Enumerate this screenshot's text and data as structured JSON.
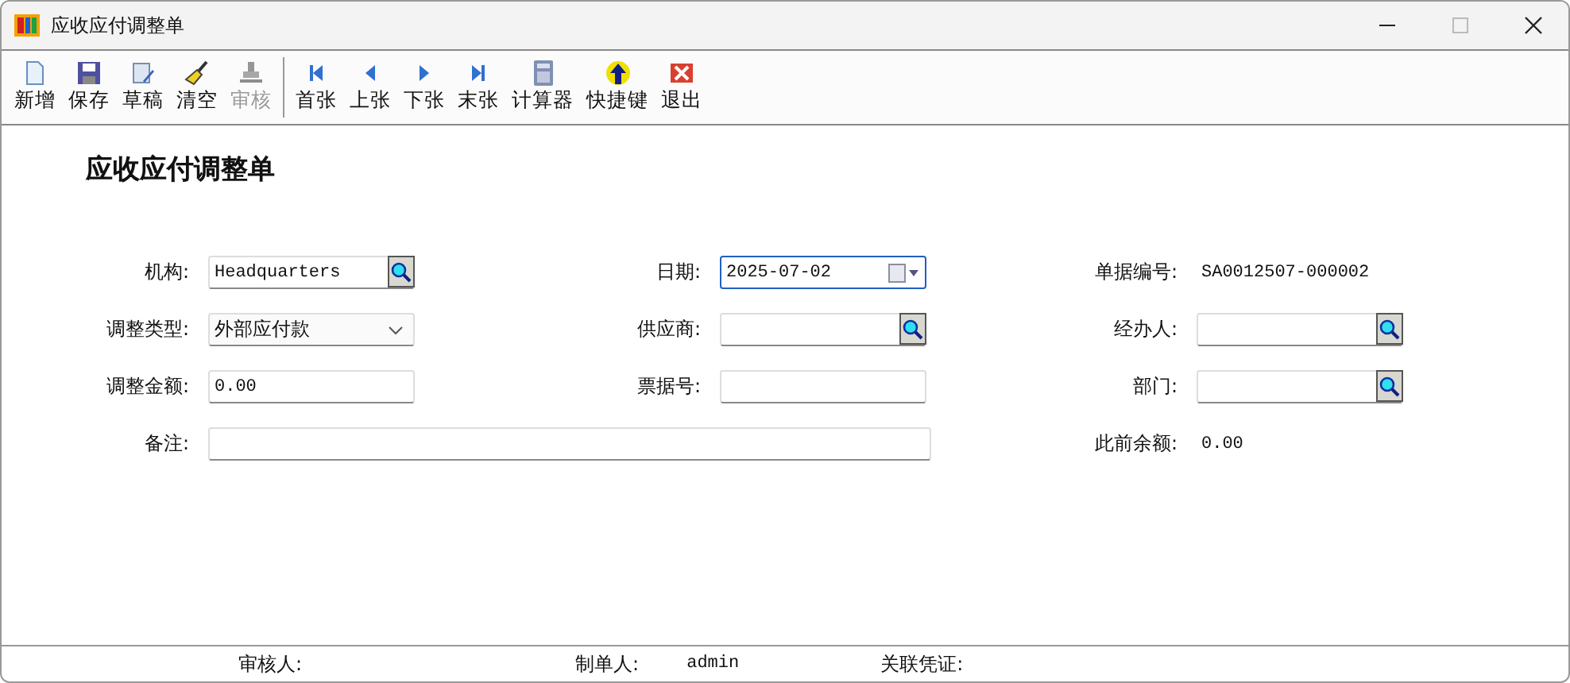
{
  "window": {
    "title": "应收应付调整单"
  },
  "toolbar": [
    {
      "label": "新增",
      "disabled": false,
      "separator_before": false
    },
    {
      "label": "保存",
      "disabled": false,
      "separator_before": false
    },
    {
      "label": "草稿",
      "disabled": false,
      "separator_before": false
    },
    {
      "label": "清空",
      "disabled": false,
      "separator_before": false
    },
    {
      "label": "审核",
      "disabled": true,
      "separator_before": false
    },
    {
      "label": "首张",
      "disabled": false,
      "separator_before": true
    },
    {
      "label": "上张",
      "disabled": false,
      "separator_before": false
    },
    {
      "label": "下张",
      "disabled": false,
      "separator_before": false
    },
    {
      "label": "末张",
      "disabled": false,
      "separator_before": false
    },
    {
      "label": "计算器",
      "disabled": false,
      "separator_before": false
    },
    {
      "label": "快捷键",
      "disabled": false,
      "separator_before": false
    },
    {
      "label": "退出",
      "disabled": false,
      "separator_before": false
    }
  ],
  "form_title": "应收应付调整单",
  "fields": [
    {
      "label": "机构:",
      "kind": "lookup",
      "value": "Headquarters"
    },
    {
      "label": "日期:",
      "kind": "date",
      "value": "2025-07-02",
      "focused": true
    },
    {
      "label": "单据编号:",
      "kind": "text",
      "value": "SA0012507-000002"
    },
    {
      "label": "调整类型:",
      "kind": "select",
      "value": "外部应付款"
    },
    {
      "label": "供应商:",
      "kind": "lookup"
    },
    {
      "label": "经办人:",
      "kind": "lookup"
    },
    {
      "label": "调整金额:",
      "kind": "input",
      "value": "0.00"
    },
    {
      "label": "票据号:",
      "kind": "input"
    },
    {
      "label": "部门:",
      "kind": "lookup"
    },
    {
      "label": "备注:",
      "kind": "wide"
    },
    {
      "label": "此前余额:",
      "kind": "text",
      "value": "0.00"
    }
  ],
  "status_bar": [
    {
      "label": "审核人:"
    },
    {
      "label": "制单人:",
      "value": "admin"
    },
    {
      "label": "关联凭证:"
    }
  ]
}
